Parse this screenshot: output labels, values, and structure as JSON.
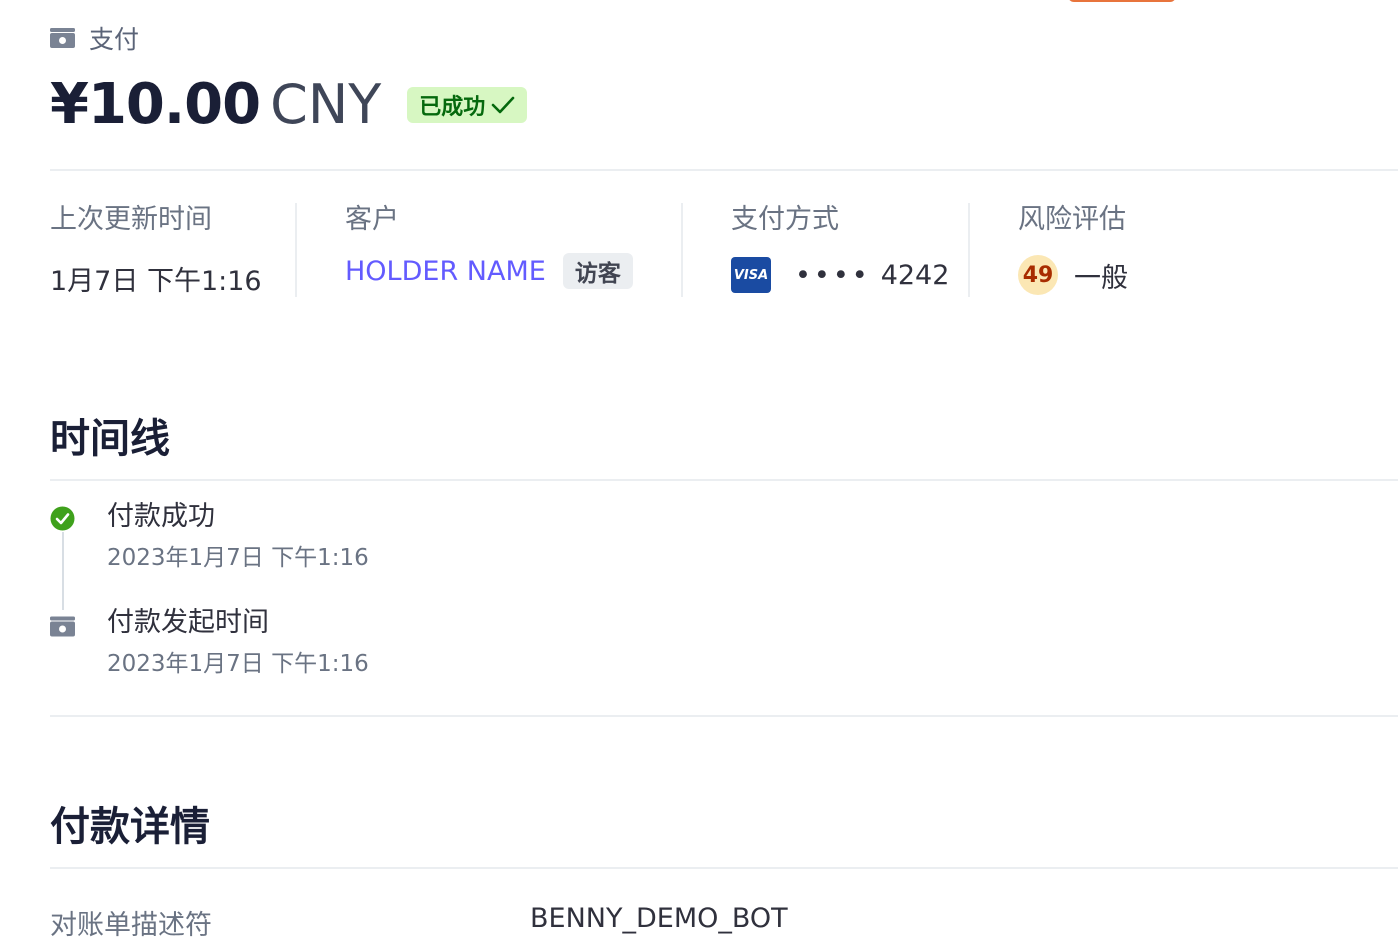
{
  "header": {
    "breadcrumb_label": "支付",
    "amount": "¥10.00",
    "currency": "CNY",
    "status_label": "已成功"
  },
  "summary": {
    "last_updated": {
      "title": "上次更新时间",
      "value": "1月7日 下午1:16"
    },
    "customer": {
      "title": "客户",
      "name": "HOLDER NAME",
      "badge": "访客"
    },
    "payment_method": {
      "title": "支付方式",
      "card_brand": "VISA",
      "dots": "••••",
      "last4": "4242"
    },
    "risk": {
      "title": "风险评估",
      "score": "49",
      "level": "一般"
    }
  },
  "timeline": {
    "title": "时间线",
    "events": [
      {
        "title": "付款成功",
        "time": "2023年1月7日 下午1:16",
        "icon": "check-circle-icon"
      },
      {
        "title": "付款发起时间",
        "time": "2023年1月7日 下午1:16",
        "icon": "payment-icon"
      }
    ]
  },
  "details": {
    "title": "付款详情",
    "rows": [
      {
        "label": "对账单描述符",
        "value": "BENNY_DEMO_BOT"
      }
    ]
  },
  "colors": {
    "accent": "#635bff",
    "success_bg": "#d7f7c2",
    "success_text": "#05690d",
    "success_icon": "#3fa11c",
    "top_bar": "#e8743c",
    "risk_bg": "#fbe7b4",
    "risk_text": "#a82c00",
    "visa_blue": "#1a4ba2"
  }
}
